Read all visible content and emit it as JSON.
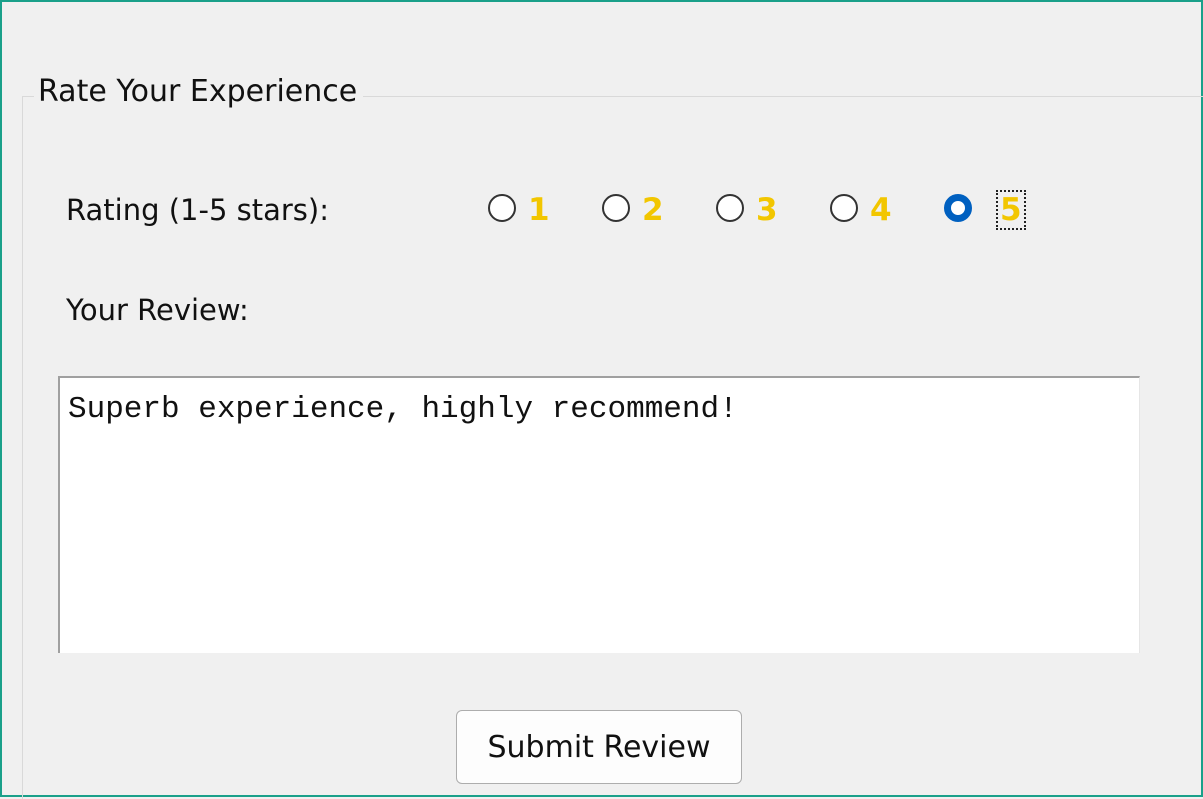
{
  "group": {
    "title": "Rate Your Experience"
  },
  "rating": {
    "label": "Rating (1-5 stars):",
    "options": [
      "1",
      "2",
      "3",
      "4",
      "5"
    ],
    "selected": "5",
    "number_color": "#f2c600",
    "selected_color": "#0060c0"
  },
  "review": {
    "label": "Your Review:",
    "value": "Superb experience, highly recommend!"
  },
  "submit": {
    "label": "Submit Review"
  },
  "colors": {
    "frame": "#1aa08a",
    "background": "#f0f0f0"
  }
}
